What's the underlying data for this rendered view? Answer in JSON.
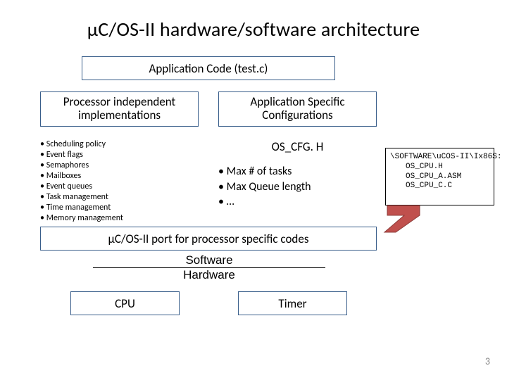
{
  "title": "μC/OS-II hardware/software architecture",
  "boxes": {
    "app_code": "Application Code (test.c)",
    "proc_indep_l1": "Processor independent",
    "proc_indep_l2": "implementations",
    "app_spec_l1": "Application Specific",
    "app_spec_l2": "Configurations",
    "port": "μC/OS-II port for processor specific codes",
    "cpu": "CPU",
    "timer": "Timer"
  },
  "impl_items": [
    "Scheduling policy",
    "Event flags",
    "Semaphores",
    "Mailboxes",
    "Event queues",
    "Task management",
    "Time management",
    "Memory management"
  ],
  "cfg": {
    "header": "OS_CFG. H",
    "items": [
      "Max # of tasks",
      "Max Queue length",
      "…"
    ]
  },
  "sw_label": "Software",
  "hw_label": "Hardware",
  "callout": {
    "path": "\\SOFTWARE\\uCOS-II\\Ix86S:",
    "files": [
      "OS_CPU.H",
      "OS_CPU_A.ASM",
      "OS_CPU_C.C"
    ]
  },
  "page_number": "3"
}
